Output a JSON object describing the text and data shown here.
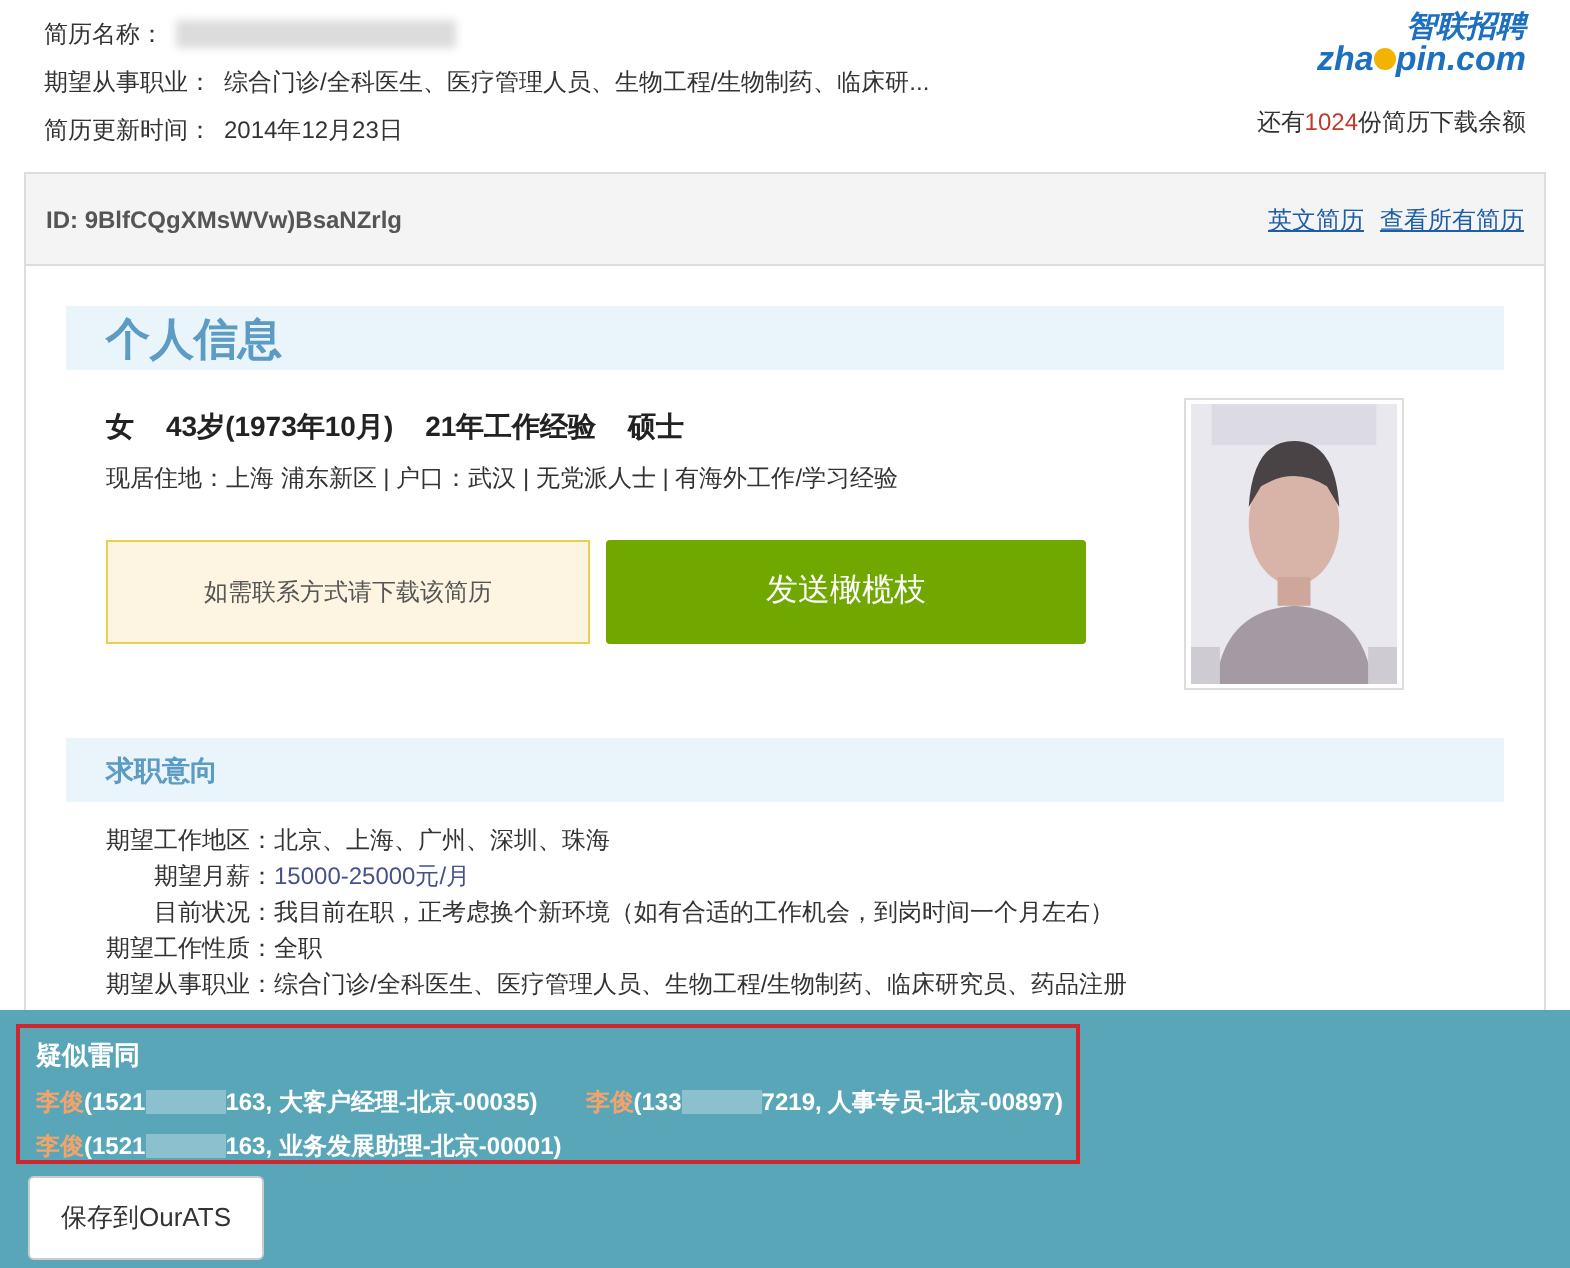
{
  "header": {
    "fields": [
      {
        "label": "简历名称：",
        "redacted": true
      },
      {
        "label": "期望从事职业：",
        "value": "综合门诊/全科医生、医疗管理人员、生物工程/生物制药、临床研...",
        "redacted": false
      },
      {
        "label": "简历更新时间：",
        "value": "2014年12月23日",
        "redacted": false
      }
    ],
    "logo": {
      "cn": "智联招聘",
      "en_left": "zha",
      "en_right": "pin.com"
    },
    "quota": {
      "before": "还有",
      "count": "1024",
      "after": "份简历下载余额"
    }
  },
  "card": {
    "id": "ID: 9BlfCQgXMsWVw)BsaNZrlg",
    "links": [
      "英文简历",
      "查看所有简历"
    ]
  },
  "personal": {
    "heading": "个人信息",
    "summary": [
      "女",
      "43岁(1973年10月)",
      "21年工作经验",
      "硕士"
    ],
    "details": "现居住地：上海 浦东新区 | 户口：武汉 | 无党派人士 | 有海外工作/学习经验",
    "notice": "如需联系方式请下载该简历",
    "send_button": "发送橄榄枝"
  },
  "intent": {
    "heading": "求职意向",
    "rows": [
      {
        "label": "期望工作地区：",
        "value": "北京、上海、广州、深圳、珠海",
        "indent": false,
        "highlight": false
      },
      {
        "label": "期望月薪：",
        "value": "15000-25000元/月",
        "indent": true,
        "highlight": true
      },
      {
        "label": "目前状况：",
        "value": "我目前在职，正考虑换个新环境（如有合适的工作机会，到岗时间一个月左右）",
        "indent": true,
        "highlight": false
      },
      {
        "label": "期望工作性质：",
        "value": "全职",
        "indent": false,
        "highlight": false
      },
      {
        "label": "期望从事职业：",
        "value": "综合门诊/全科医生、医疗管理人员、生物工程/生物制药、临床研究员、药品注册",
        "indent": false,
        "highlight": false
      }
    ]
  },
  "similar": {
    "title": "疑似雷同",
    "matches": [
      {
        "name": "李俊",
        "phone_start": "(1521",
        "phone_end": "163,",
        "detail": "大客户经理-北京-00035)"
      },
      {
        "name": "李俊",
        "phone_start": "(133",
        "phone_end": "7219,",
        "detail": "人事专员-北京-00897)"
      },
      {
        "name": "李俊",
        "phone_start": "(1521",
        "phone_end": "163,",
        "detail": "业务发展助理-北京-00001)"
      }
    ],
    "save_button": "保存到OurATS"
  }
}
